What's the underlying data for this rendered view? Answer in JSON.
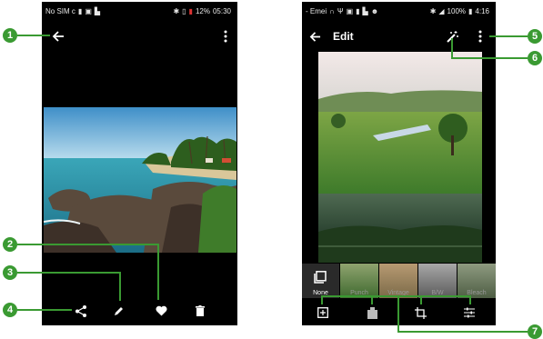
{
  "left_screen": {
    "status": {
      "carrier": "No SIM c",
      "battery_pct": "12%",
      "time": "05:30"
    },
    "icons": {
      "back": "arrow-left-icon",
      "menu": "more-vert-icon",
      "share": "share-icon",
      "edit": "pencil-icon",
      "favorite": "heart-icon",
      "delete": "trash-icon"
    }
  },
  "right_screen": {
    "status": {
      "carrier": "- Emei",
      "battery_pct": "100%",
      "time": "4:16"
    },
    "title": "Edit",
    "filters": [
      {
        "label": "None"
      },
      {
        "label": "Punch"
      },
      {
        "label": "Vintage"
      },
      {
        "label": "B/W"
      },
      {
        "label": "Bleach"
      }
    ],
    "icons": {
      "back": "arrow-left-icon",
      "auto_fix": "magic-wand-icon",
      "menu": "more-vert-icon"
    }
  },
  "callouts": [
    "1",
    "2",
    "3",
    "4",
    "5",
    "6",
    "7"
  ],
  "colors": {
    "callout": "#3a9a32",
    "background": "#000000"
  }
}
